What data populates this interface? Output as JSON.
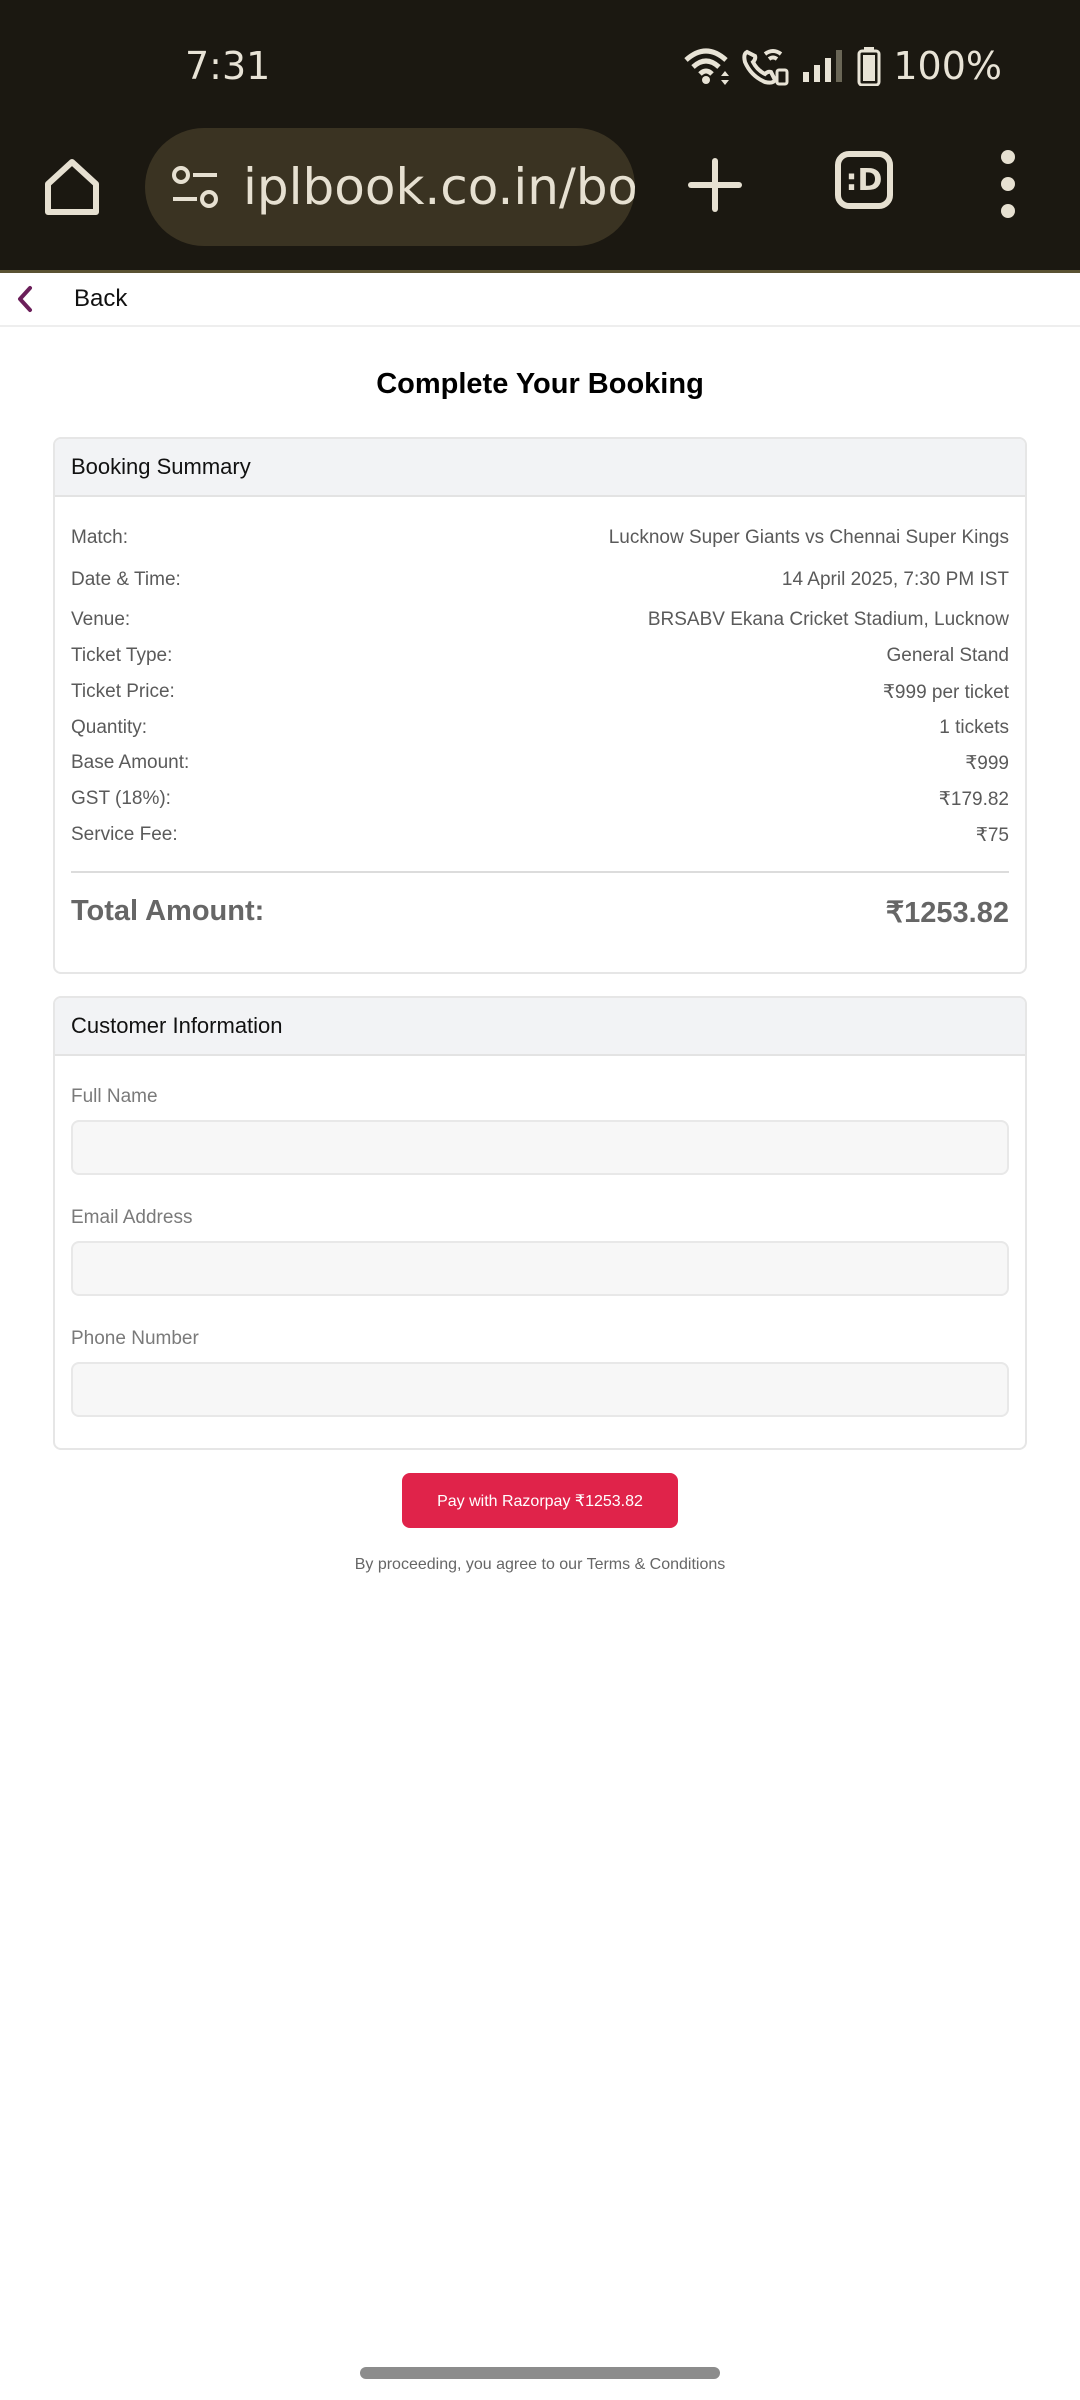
{
  "status_bar": {
    "time": "7:31",
    "battery_percent": "100%",
    "icons": [
      "wifi-icon",
      "wifi-calling-icon",
      "signal-icon",
      "battery-icon"
    ]
  },
  "browser": {
    "url": "iplbook.co.in/boo",
    "tabs_label": ":D",
    "icons": [
      "home-icon",
      "site-settings-icon",
      "new-tab-icon",
      "tab-switcher-icon",
      "more-vert-icon"
    ]
  },
  "nav": {
    "back_label": "Back"
  },
  "page": {
    "title": "Complete Your Booking"
  },
  "summary": {
    "header": "Booking Summary",
    "rows": [
      {
        "label": "Match:",
        "value": "Lucknow Super Giants vs Chennai Super Kings"
      },
      {
        "label": "Date & Time:",
        "value": "14 April 2025, 7:30 PM IST"
      },
      {
        "label": "Venue:",
        "value": "BRSABV Ekana Cricket Stadium, Lucknow"
      },
      {
        "label": "Ticket Type:",
        "value": "General Stand"
      },
      {
        "label": "Ticket Price:",
        "value": "₹999 per ticket"
      },
      {
        "label": "Quantity:",
        "value": "1 tickets"
      },
      {
        "label": "Base Amount:",
        "value": "₹999"
      },
      {
        "label": "GST (18%):",
        "value": "₹179.82"
      },
      {
        "label": "Service Fee:",
        "value": "₹75"
      }
    ],
    "total_label": "Total Amount:",
    "total_value": "₹1253.82"
  },
  "customer": {
    "header": "Customer Information",
    "fields": [
      {
        "label": "Full Name",
        "value": "",
        "placeholder": ""
      },
      {
        "label": "Email Address",
        "value": "",
        "placeholder": ""
      },
      {
        "label": "Phone Number",
        "value": "",
        "placeholder": ""
      }
    ]
  },
  "actions": {
    "pay_label": "Pay with Razorpay ₹1253.82",
    "terms_text": "By proceeding, you agree to our Terms & Conditions"
  },
  "colors": {
    "chrome_bg": "#1b1811",
    "pay_button": "#e0234a",
    "back_chevron": "#6b1f5a"
  }
}
